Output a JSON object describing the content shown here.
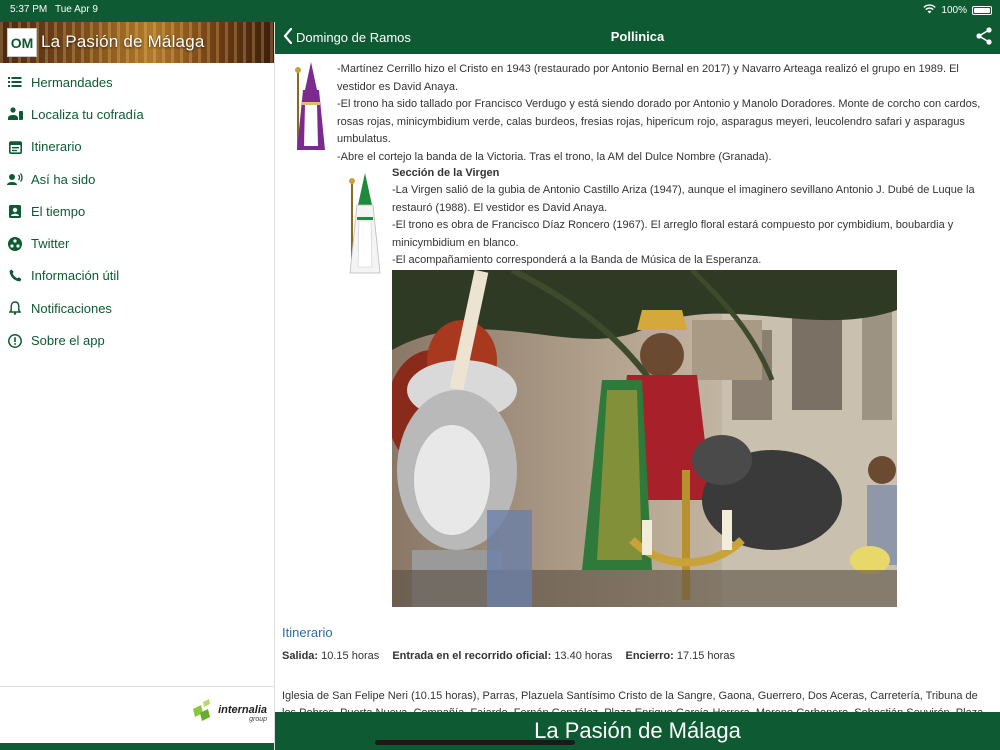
{
  "status": {
    "time": "5:37 PM",
    "date": "Tue Apr 9",
    "battery": "100%"
  },
  "sidebar": {
    "logo_text": "OM",
    "title": "La Pasión de Málaga",
    "items": [
      {
        "label": "Hermandades",
        "icon": "list-icon"
      },
      {
        "label": "Localiza tu cofradía",
        "icon": "person-location-icon"
      },
      {
        "label": "Itinerario",
        "icon": "calendar-icon"
      },
      {
        "label": "Así ha sido",
        "icon": "record-voice-icon"
      },
      {
        "label": "El tiempo",
        "icon": "weather-badge-icon"
      },
      {
        "label": "Twitter",
        "icon": "twitter-icon"
      },
      {
        "label": "Información útil",
        "icon": "phone-icon"
      },
      {
        "label": "Notificaciones",
        "icon": "bell-icon"
      },
      {
        "label": "Sobre el app",
        "icon": "info-icon"
      }
    ],
    "sponsor_name": "internalia",
    "sponsor_sub": "group"
  },
  "navbar": {
    "back_label": "Domingo de Ramos",
    "title": "Pollinica"
  },
  "content": {
    "cristo_text": [
      "-Martínez Cerrillo hizo el Cristo en 1943 (restaurado por Antonio Bernal en 2017) y Navarro Arteaga realizó el grupo en 1989. El",
      "vestidor es David Anaya.",
      "-El trono ha sido tallado por Francisco Verdugo y está siendo dorado por Antonio y Manolo Doradores. Monte de corcho con cardos,",
      "rosas rojas, minicymbidium verde, calas burdeos, fresias rojas, hipericum rojo, asparagus meyeri, leucolendro safari y asparagus",
      "umbulatus.",
      "-Abre el cortejo la banda de la Victoria. Tras el trono, la AM del Dulce Nombre (Granada)."
    ],
    "virgen_title": "Sección de la Virgen",
    "virgen_text": [
      "-La Virgen salió de la gubia de Antonio Castillo Ariza (1947), aunque el imaginero sevillano Antonio J. Dubé de Luque la",
      "restauró (1988). El vestidor es David Anaya.",
      "-El trono es obra de Francisco Díaz Roncero (1967).  El arreglo floral estará compuesto por cymbidium, boubardia y",
      "minicymbidium en blanco.",
      "-El acompañamiento corresponderá a la Banda de Música de la Esperanza."
    ],
    "itinerario_title": "Itinerario",
    "salida_label": "Salida:",
    "salida_value": "10.15 horas",
    "entrada_label": "Entrada en el recorrido oficial:",
    "entrada_value": "13.40 horas",
    "encierro_label": "Encierro:",
    "encierro_value": "17.15 horas",
    "route_text": "Iglesia de San Felipe Neri (10.15 horas), Parras, Plazuela Santísimo Cristo de la Sangre, Gaona, Guerrero, Dos Aceras, Carretería, Tribuna de los Pobres, Puerta Nueva, Compañía, Fajardo, Fernán González, Plaza Enrique García-Herrera, Moreno Carbonero, Sebastián Souvirón, Plaza"
  },
  "bottom_banner": {
    "title": "La Pasión de Málaga"
  },
  "colors": {
    "brand_green": "#0e5a32",
    "link_blue": "#2a6fa8",
    "cristo_robe": "#7b2b8f",
    "virgen_hood": "#1e8a3c"
  }
}
